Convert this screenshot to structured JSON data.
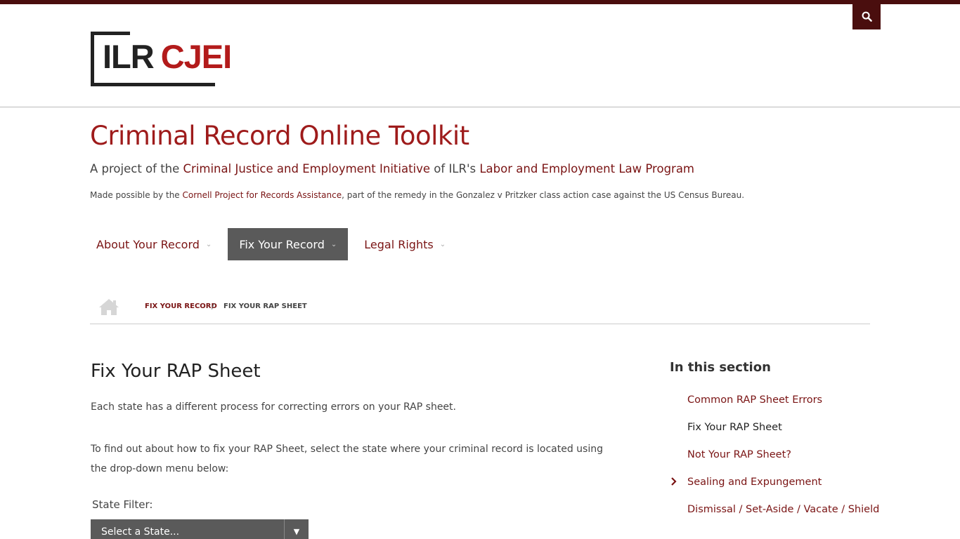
{
  "header": {
    "logo": {
      "ilr": "ILR",
      "cjei": "CJEI"
    },
    "search_icon": "search-icon"
  },
  "site": {
    "title": "Criminal Record Online Toolkit",
    "tagline": {
      "prefix": "A project of the ",
      "link1": "Criminal Justice and Employment Initiative",
      "middle": " of ILR's ",
      "link2": "Labor and Employment Law Program"
    },
    "madeby": {
      "prefix": "Made possible by the ",
      "link": "Cornell Project for Records Assistance",
      "suffix": ", part of the remedy in the Gonzalez v Pritzker class action case against the US Census Bureau."
    }
  },
  "nav": {
    "items": [
      {
        "label": "About Your Record"
      },
      {
        "label": "Fix Your Record"
      },
      {
        "label": "Legal Rights"
      }
    ]
  },
  "breadcrumb": {
    "home_icon": "home-icon",
    "link": "Fix Your Record",
    "separator": "/",
    "current": "Fix Your RAP Sheet"
  },
  "main": {
    "title": "Fix Your RAP Sheet",
    "para1": "Each state has a different process for correcting errors on your RAP sheet.",
    "para2": "To find out about how to fix your RAP Sheet, select the state where your criminal record is located using the drop-down menu below:",
    "filter_label": "State Filter:",
    "select_value": "Select a State...",
    "select_arrow": "▼"
  },
  "sidebar": {
    "title": "In this section",
    "items": [
      {
        "label": "Common RAP Sheet Errors"
      },
      {
        "label": "Fix Your RAP Sheet"
      },
      {
        "label": "Not Your RAP Sheet?"
      },
      {
        "label": "Sealing and Expungement"
      },
      {
        "label": "Dismissal / Set-Aside / Vacate / Shield"
      }
    ]
  },
  "colors": {
    "brand_dark": "#4a0e0e",
    "brand_red": "#9e1b1b",
    "link": "#7a1414",
    "nav_active_bg": "#5a5a5a"
  }
}
